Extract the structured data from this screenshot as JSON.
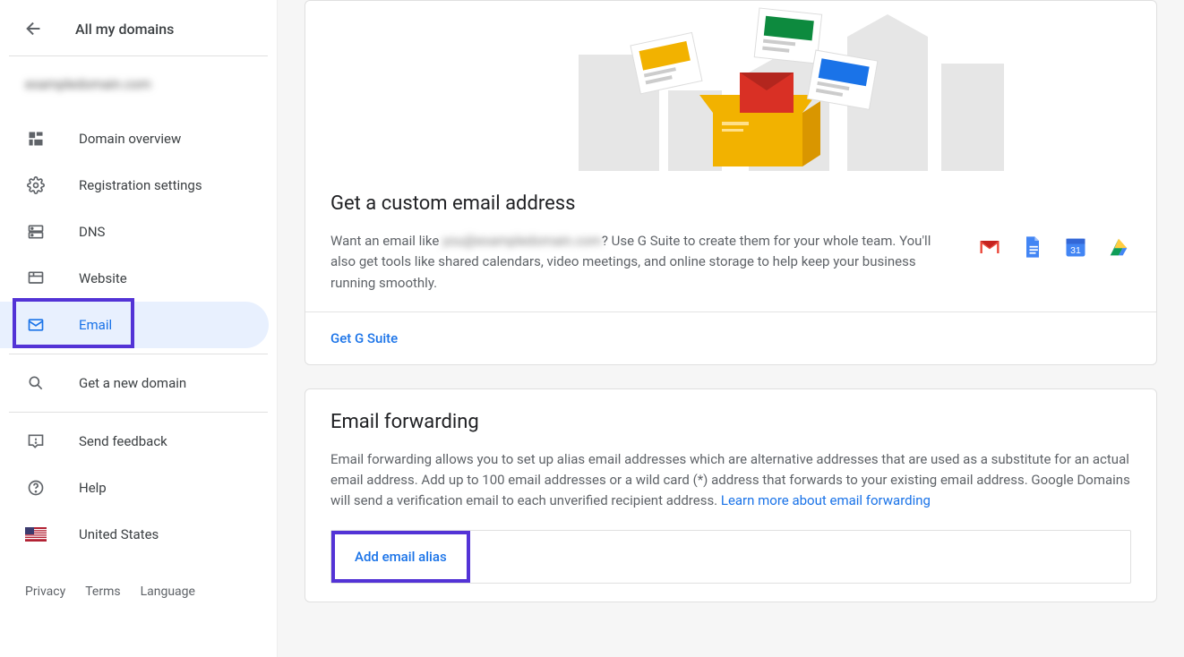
{
  "sidebar": {
    "back_title": "All my domains",
    "domain_blurred": "exampledomain.com",
    "items": [
      {
        "key": "overview",
        "label": "Domain overview"
      },
      {
        "key": "registration",
        "label": "Registration settings"
      },
      {
        "key": "dns",
        "label": "DNS"
      },
      {
        "key": "website",
        "label": "Website"
      },
      {
        "key": "email",
        "label": "Email",
        "active": true,
        "highlighted": true
      },
      {
        "key": "getdomain",
        "label": "Get a new domain"
      },
      {
        "key": "feedback",
        "label": "Send feedback"
      },
      {
        "key": "help",
        "label": "Help"
      },
      {
        "key": "country",
        "label": "United States"
      }
    ],
    "footer": {
      "privacy": "Privacy",
      "terms": "Terms",
      "language": "Language"
    }
  },
  "custom_email": {
    "heading": "Get a custom email address",
    "desc_prefix": "Want an email like ",
    "desc_blurred": "you@exampledomain.com",
    "desc_suffix": "? Use G Suite to create them for your whole team. You'll also get tools like shared calendars, video meetings, and online storage to help keep your business running smoothly.",
    "cta": "Get G Suite"
  },
  "forwarding": {
    "heading": "Email forwarding",
    "desc": "Email forwarding allows you to set up alias email addresses which are alternative addresses that are used as a substitute for an actual email address. Add up to 100 email addresses or a wild card (*) address that forwards to your existing email address. Google Domains will send a verification email to each unverified recipient address. ",
    "learn_more": "Learn more about email forwarding",
    "add_alias": "Add email alias"
  }
}
